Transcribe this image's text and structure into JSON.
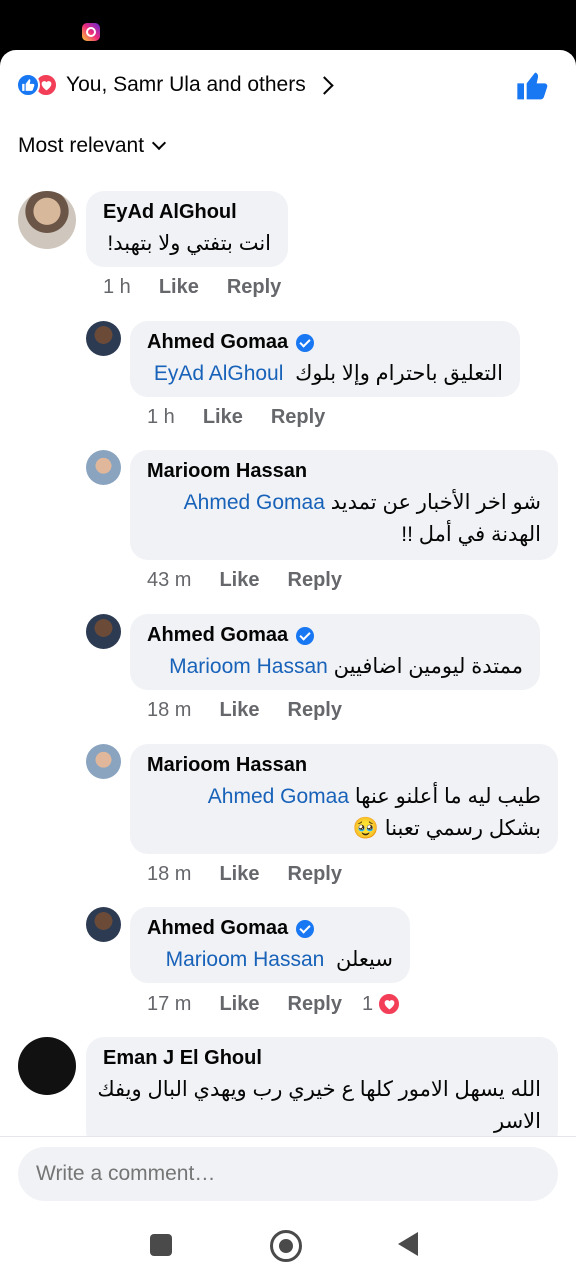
{
  "reactions": {
    "text": "You, Samr Ula and others"
  },
  "sort": {
    "label": "Most relevant"
  },
  "comments": [
    {
      "name": "EyAd AlGhoul",
      "text": "انت بتفتي ولا بتهبد!",
      "time": "1 h",
      "like": "Like",
      "reply": "Reply"
    },
    {
      "name": "Ahmed Gomaa",
      "mention": "EyAd AlGhoul",
      "text": "التعليق باحترام وإلا بلوك",
      "time": "1 h",
      "like": "Like",
      "reply": "Reply"
    },
    {
      "name": "Marioom Hassan",
      "mention": "Ahmed Gomaa",
      "text": "شو اخر الأخبار عن تمديد",
      "text2": "الهدنة في أمل !!",
      "time": "43 m",
      "like": "Like",
      "reply": "Reply"
    },
    {
      "name": "Ahmed Gomaa",
      "mention": "Marioom Hassan",
      "text": "ممتدة ليومين اضافيين",
      "time": "18 m",
      "like": "Like",
      "reply": "Reply"
    },
    {
      "name": "Marioom Hassan",
      "mention": "Ahmed Gomaa",
      "text": "طيب ليه ما أعلنو عنها",
      "text2": "بشكل رسمي تعبنا 🥹",
      "time": "18 m",
      "like": "Like",
      "reply": "Reply"
    },
    {
      "name": "Ahmed Gomaa",
      "mention": "Marioom Hassan",
      "text": "سيعلن",
      "time": "17 m",
      "like": "Like",
      "reply": "Reply",
      "reaction_count": "1"
    },
    {
      "name": "Eman J El Ghoul",
      "text": "الله يسهل الامور كلها ع خيري رب ويهدي البال ويفك",
      "text2": "الاسر"
    }
  ],
  "input": {
    "placeholder": "Write a comment…"
  },
  "colors": {
    "accent": "#1877f2",
    "love": "#f33e58",
    "mention": "#1862b9"
  }
}
